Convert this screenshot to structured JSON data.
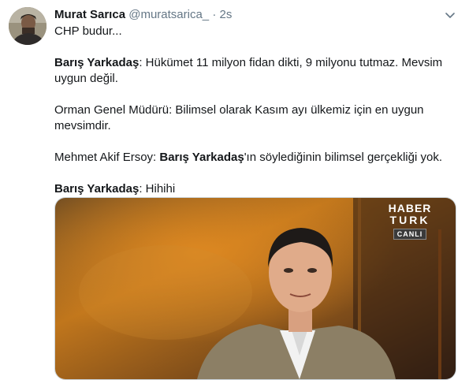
{
  "tweet": {
    "author_name": "Murat Sarıca",
    "handle": "@muratsarica_",
    "separator": "·",
    "time": "2s",
    "text": {
      "line1": "CHP budur...",
      "p2_name": "Barış Yarkadaş",
      "p2_text": ": Hükümet 11 milyon fidan dikti, 9 milyonu tutmaz. Mevsim uygun değil.",
      "p3_text": "Orman Genel Müdürü: Bilimsel olarak Kasım ayı ülkemiz için en uygun mevsimdir.",
      "p4_prefix": "Mehmet Akif Ersoy: ",
      "p4_name": "Barış Yarkadaş",
      "p4_suffix": "'ın söylediğinin bilimsel gerçekliği yok.",
      "p5_name": "Barış Yarkadaş",
      "p5_text": ": Hihihi"
    },
    "media": {
      "logo_line1": "HABER",
      "logo_line2": "TURK",
      "logo_live": "CANLI"
    },
    "icons": {
      "menu": "chevron-down-icon"
    },
    "colors": {
      "name": "#14171a",
      "secondary": "#657786",
      "border": "#ccd6dd"
    }
  }
}
